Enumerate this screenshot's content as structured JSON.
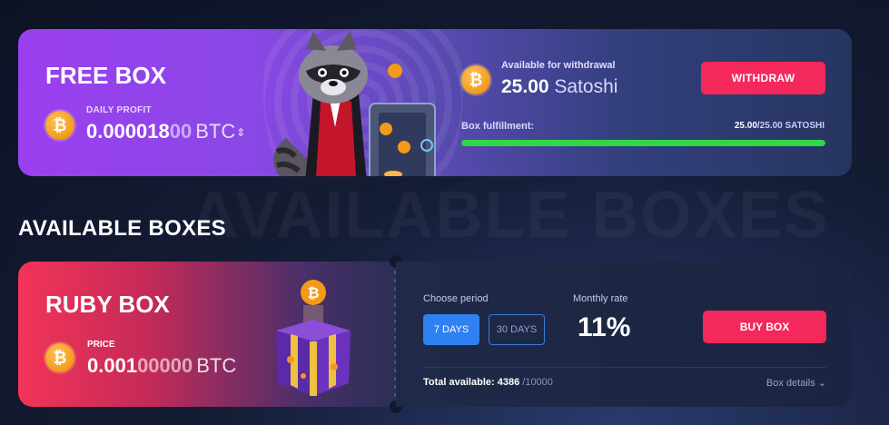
{
  "watermark": "AVAILABLE BOXES",
  "free_box": {
    "title": "FREE BOX",
    "daily_profit_label": "DAILY PROFIT",
    "daily_profit_main": "0.00001800",
    "daily_profit_bright": "0.000018",
    "daily_profit_dim": "00",
    "daily_profit_unit": "BTC",
    "available_label": "Available for withdrawal",
    "available_amount": "25.00",
    "available_unit": "Satoshi",
    "withdraw_label": "WITHDRAW",
    "fulfillment_label": "Box fulfillment:",
    "fulfillment_current": "25.00",
    "fulfillment_total": "/25.00 SATOSHI",
    "fulfillment_progress": 1.0,
    "progress_color": "#2fd845"
  },
  "section_title": "AVAILABLE BOXES",
  "ruby_box": {
    "title": "RUBY BOX",
    "price_label": "PRICE",
    "price_bright": "0.001",
    "price_dim": "00000",
    "price_unit": "BTC",
    "choose_period_label": "Choose period",
    "period_options": [
      "7 DAYS",
      "30 DAYS"
    ],
    "selected_period": "7 DAYS",
    "monthly_rate_label": "Monthly rate",
    "monthly_rate": "11%",
    "buy_label": "BUY BOX",
    "total_label": "Total available:",
    "total_available": "4386",
    "total_max": "/10000",
    "details_label": "Box details"
  },
  "colors": {
    "accent_red": "#f5285b",
    "accent_blue": "#2f80f0",
    "coin_orange": "#f39a1a"
  },
  "icons": {
    "coin": "bitcoin-coin-icon",
    "chevron": "chevron-down-icon",
    "sort": "up-down-arrows-icon"
  }
}
